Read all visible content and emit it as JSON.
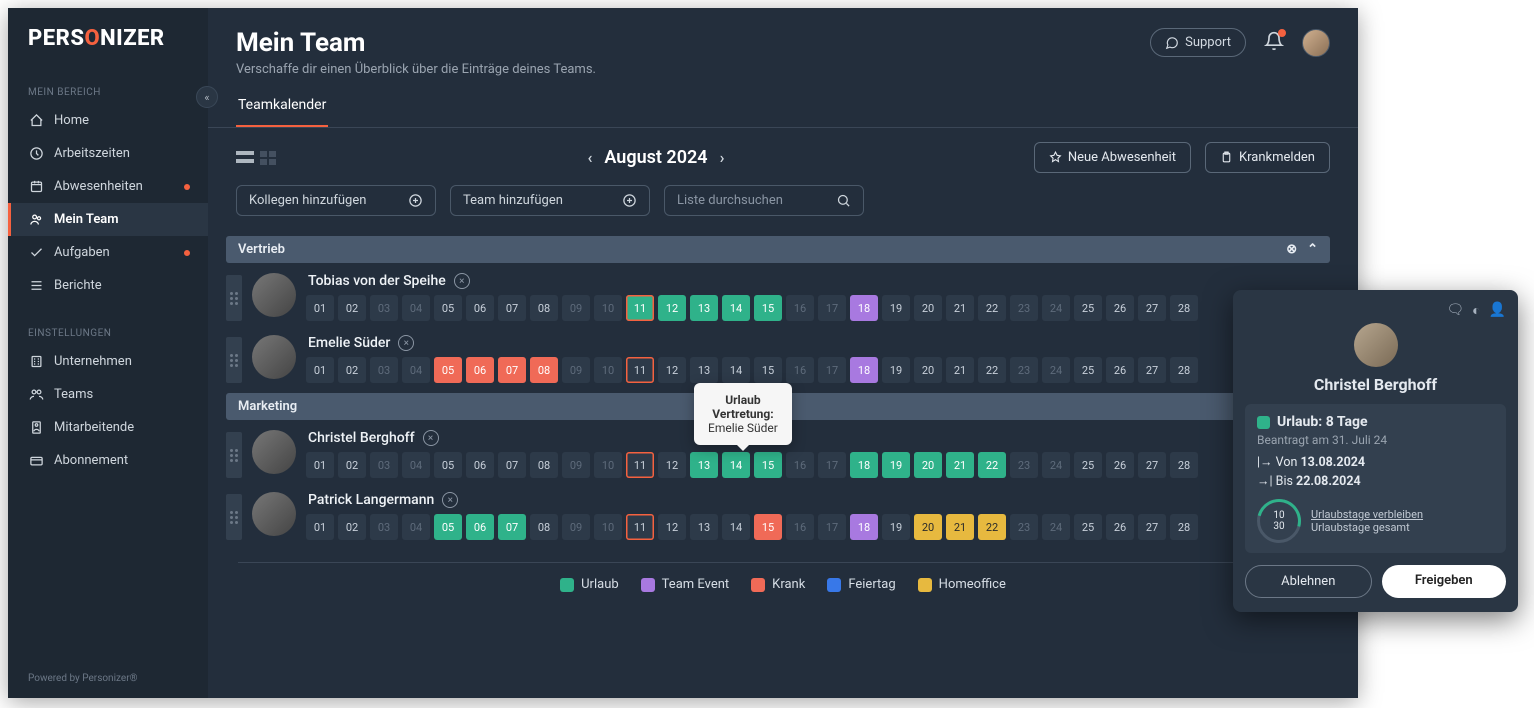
{
  "brand": "PERSONIZER",
  "sidebar": {
    "section1": "MEIN BEREICH",
    "section2": "EINSTELLUNGEN",
    "items1": [
      {
        "label": "Home"
      },
      {
        "label": "Arbeitszeiten"
      },
      {
        "label": "Abwesenheiten",
        "dot": true
      },
      {
        "label": "Mein Team",
        "active": true
      },
      {
        "label": "Aufgaben",
        "dot": true
      },
      {
        "label": "Berichte"
      }
    ],
    "items2": [
      {
        "label": "Unternehmen"
      },
      {
        "label": "Teams"
      },
      {
        "label": "Mitarbeitende"
      },
      {
        "label": "Abonnement"
      }
    ],
    "powered": "Powered by Personizer®"
  },
  "header": {
    "title": "Mein Team",
    "subtitle": "Verschaffe dir einen Überblick über die Einträge deines Teams.",
    "support": "Support"
  },
  "tabs": [
    {
      "label": "Teamkalender",
      "active": true
    }
  ],
  "toolbar": {
    "month": "August 2024",
    "new_absence": "Neue Abwesenheit",
    "sick": "Krankmelden",
    "add_colleague": "Kollegen hinzufügen",
    "add_team": "Team hinzufügen",
    "search_placeholder": "Liste durchsuchen"
  },
  "legend": {
    "urlaub": "Urlaub",
    "team": "Team Event",
    "krank": "Krank",
    "feiertag": "Feiertag",
    "home": "Homeoffice"
  },
  "colors": {
    "urlaub": "#2fb28a",
    "team": "#a879e0",
    "krank": "#f06a57",
    "feiertag": "#3878e8",
    "home": "#e7b93f",
    "accent": "#f5613f"
  },
  "today": 11,
  "groups": [
    {
      "name": "Vertrieb",
      "members": [
        {
          "name": "Tobias von der Speihe",
          "days": {
            "11": "urlaub",
            "12": "urlaub",
            "13": "urlaub",
            "14": "urlaub",
            "15": "urlaub",
            "18": "team"
          },
          "dim": [
            3,
            4,
            9,
            10,
            16,
            17,
            23,
            24
          ]
        },
        {
          "name": "Emelie Süder",
          "days": {
            "5": "krank",
            "6": "krank",
            "7": "krank",
            "8": "krank",
            "18": "team"
          },
          "dim": [
            3,
            4,
            9,
            10,
            16,
            17,
            23,
            24
          ]
        }
      ]
    },
    {
      "name": "Marketing",
      "members": [
        {
          "name": "Christel Berghoff",
          "days": {
            "13": "urlaub",
            "14": "urlaub",
            "15": "urlaub",
            "18": "urlaub",
            "19": "urlaub",
            "20": "urlaub",
            "21": "urlaub",
            "22": "urlaub"
          },
          "dim": [
            3,
            4,
            9,
            10,
            16,
            17,
            23,
            24
          ]
        },
        {
          "name": "Patrick Langermann",
          "days": {
            "5": "urlaub",
            "6": "urlaub",
            "7": "urlaub",
            "15": "krank",
            "18": "team",
            "20": "home",
            "21": "home",
            "22": "home"
          },
          "dim": [
            3,
            4,
            9,
            10,
            16,
            17,
            23,
            24
          ]
        }
      ]
    }
  ],
  "tooltip": {
    "line1": "Urlaub",
    "line2": "Vertretung:",
    "line3": "Emelie Süder"
  },
  "popover": {
    "name": "Christel Berghoff",
    "chip": "Urlaub: 8 Tage",
    "requested": "Beantragt am 31. Juli 24",
    "from_label": "Von",
    "from": "13.08.2024",
    "to_label": "Bis",
    "to": "22.08.2024",
    "ring_top": "10",
    "ring_bot": "30",
    "rem_label": "Urlaubstage verbleiben",
    "total_label": "Urlaubstage gesamt",
    "decline": "Ablehnen",
    "approve": "Freigeben"
  }
}
